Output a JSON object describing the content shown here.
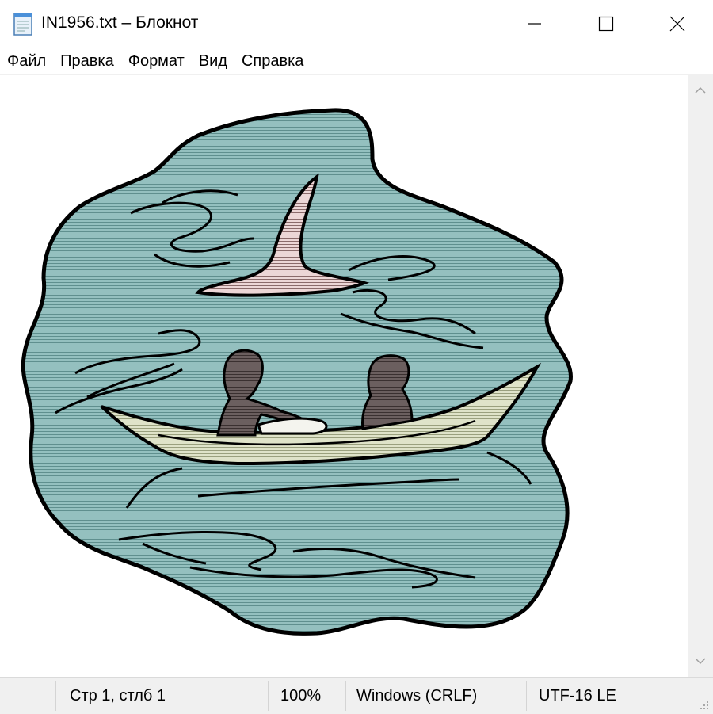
{
  "window": {
    "title": "IN1956.txt – Блокнот",
    "controls": [
      "minimize",
      "maximize",
      "close"
    ]
  },
  "menu": {
    "items": [
      "Файл",
      "Правка",
      "Формат",
      "Вид",
      "Справка"
    ]
  },
  "editor": {
    "content_type": "ascii-art picture of two people rowing a canoe past a shark fin in teal water"
  },
  "statusbar": {
    "position": "Стр 1, стлб 1",
    "zoom": "100%",
    "line_endings": "Windows (CRLF)",
    "encoding": "UTF-16 LE"
  },
  "colors": {
    "water": "#8fbcbc",
    "fin": "#e8c8c8",
    "canoe": "#d6dcc0",
    "people": "#5a4e4e",
    "outline": "#000000"
  }
}
